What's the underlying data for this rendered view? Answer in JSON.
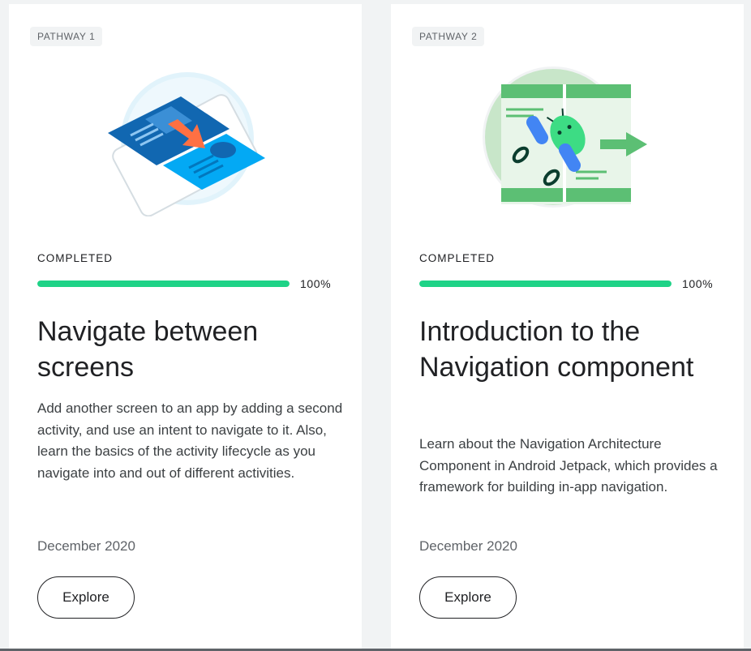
{
  "cards": [
    {
      "badge": "PATHWAY 1",
      "status": "COMPLETED",
      "progress_percent": 100,
      "progress_text": "100%",
      "title": "Navigate between screens",
      "description": "Add another screen to an app by adding a second activity, and use an intent to navigate to it. Also, learn the basics of the activity lifecycle as you navigate into and out of different activities.",
      "date": "December 2020",
      "button_label": "Explore"
    },
    {
      "badge": "PATHWAY 2",
      "status": "COMPLETED",
      "progress_percent": 100,
      "progress_text": "100%",
      "title": "Introduction to the Navigation component",
      "description": "Learn about the Navigation Architecture Component in Android Jetpack, which provides a framework for building in-app navigation.",
      "date": "December 2020",
      "button_label": "Explore"
    }
  ],
  "colors": {
    "progress": "#1ed387",
    "page_background": "#f1f3f4",
    "card_background": "#ffffff"
  }
}
